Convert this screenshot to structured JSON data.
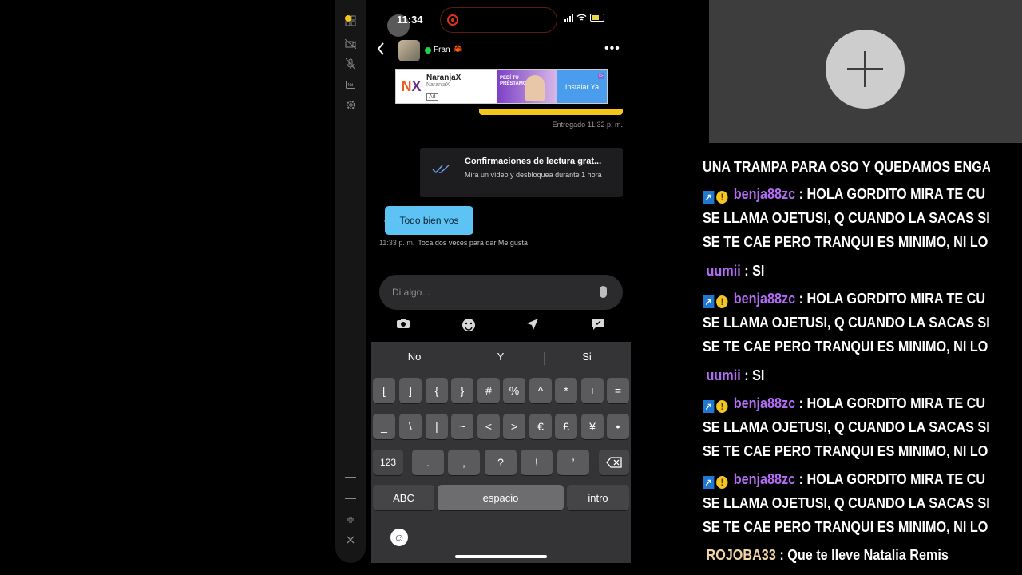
{
  "statusbar": {
    "time": "11:34"
  },
  "chat": {
    "contact_name": "Fran",
    "contact_emoji": "🦀",
    "ad": {
      "brand_logo": "NX",
      "brand": "NaranjaX",
      "brand_sub": "NaranjaX",
      "tag": "Ad",
      "image_text": "PEDÍ TU PRÉSTAMO",
      "cta": "Instalar Ya"
    },
    "delivered": "Entregado 11:32 p. m.",
    "read_receipts": {
      "title": "Confirmaciones de lectura grat...",
      "body": "Mira un vídeo y desbloquea durante 1 hora"
    },
    "message": {
      "text": "Todo bien vos",
      "time": "11:33 p. m.",
      "hint": "Toca dos veces para dar Me gusta"
    },
    "input_placeholder": "Di algo..."
  },
  "keyboard": {
    "suggestions": [
      "No",
      "Y",
      "Si"
    ],
    "row1": [
      "[",
      "]",
      "{",
      "}",
      "#",
      "%",
      "^",
      "*",
      "+",
      "="
    ],
    "row2": [
      "_",
      "\\",
      "|",
      "~",
      "<",
      ">",
      "€",
      "£",
      "¥",
      "•"
    ],
    "row3": {
      "mode": "123",
      "keys": [
        ".",
        ",",
        "?",
        "!",
        "’"
      ]
    },
    "abc": "ABC",
    "space": "espacio",
    "enter": "intro"
  },
  "stream_chat": {
    "lines": [
      {
        "text": "UNA TRAMPA PARA OSO Y QUEDAMOS ENGA"
      },
      {
        "user": "benja88zc",
        "color": "#b46cf7",
        "badges": true,
        "text": ": HOLA GORDITO MIRA TE CU",
        "cont": [
          "SE LLAMA OJETUSI, Q CUANDO LA SACAS SI",
          "SE TE CAE PERO TRANQUI ES MINIMO, NI LO"
        ]
      },
      {
        "user": "uumii",
        "color": "#b46cf7",
        "text": ": SI"
      },
      {
        "user": "benja88zc",
        "color": "#b46cf7",
        "badges": true,
        "text": ": HOLA GORDITO MIRA TE CU",
        "cont": [
          "SE LLAMA OJETUSI, Q CUANDO LA SACAS SI",
          "SE TE CAE PERO TRANQUI ES MINIMO, NI LO"
        ]
      },
      {
        "user": "uumii",
        "color": "#b46cf7",
        "text": ": SI"
      },
      {
        "user": "benja88zc",
        "color": "#b46cf7",
        "badges": true,
        "text": ": HOLA GORDITO MIRA TE CU",
        "cont": [
          "SE LLAMA OJETUSI, Q CUANDO LA SACAS SI",
          "SE TE CAE PERO TRANQUI ES MINIMO, NI LO"
        ]
      },
      {
        "user": "benja88zc",
        "color": "#b46cf7",
        "badges": true,
        "text": ": HOLA GORDITO MIRA TE CU",
        "cont": [
          "SE LLAMA OJETUSI, Q CUANDO LA SACAS SI",
          "SE TE CAE PERO TRANQUI ES MINIMO, NI LO"
        ]
      },
      {
        "user": "ROJOBA33",
        "color": "#f1d6a5",
        "text": ": Que te lleve Natalia Remis"
      }
    ]
  }
}
